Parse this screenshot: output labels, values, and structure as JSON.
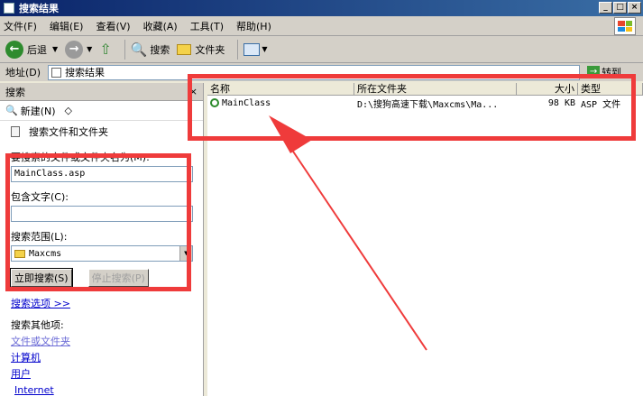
{
  "window": {
    "title": "搜索结果"
  },
  "titlebar": {
    "minimize": "_",
    "maximize": "□",
    "close": "×"
  },
  "menu": [
    "文件(F)",
    "编辑(E)",
    "查看(V)",
    "收藏(A)",
    "工具(T)",
    "帮助(H)"
  ],
  "toolbar": {
    "back_label": "后退",
    "search_label": "搜索",
    "folders_label": "文件夹"
  },
  "address": {
    "label": "地址(D)",
    "value": "搜索结果",
    "go_label": "转到"
  },
  "left_pane": {
    "header": "搜索",
    "close": "×",
    "new_label": "新建(N)",
    "search_all": "搜索文件和文件夹",
    "name_label": "要搜索的文件或文件夹名为(M):",
    "name_value": "MainClass.asp",
    "text_label": "包含文字(C):",
    "text_value": "",
    "scope_label": "搜索范围(L):",
    "scope_value": "Maxcms",
    "search_now": "立即搜索(S)",
    "stop_search": "停止搜索(P)",
    "options_link": "搜索选项 >>",
    "other_label": "搜索其他项:",
    "other_items": [
      "文件或文件夹",
      "计算机",
      "用户",
      "Internet"
    ]
  },
  "table": {
    "columns": [
      "名称",
      "所在文件夹",
      "大小",
      "类型"
    ],
    "rows": [
      {
        "name": "MainClass",
        "folder": "D:\\搜狗高速下载\\Maxcms\\Ma...",
        "size": "98 KB",
        "type": "ASP 文件"
      }
    ]
  },
  "colors": {
    "annotation": "#ef3b3b",
    "titlebar": "#0a246a"
  }
}
